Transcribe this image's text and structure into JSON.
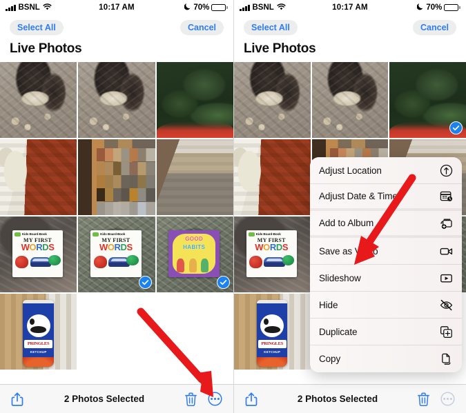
{
  "status_bar": {
    "carrier": "BSNL",
    "wifi_icon": "wifi-icon",
    "signal_icon": "signal-bars-icon",
    "time": "10:17 AM",
    "moon_icon": "moon-crescent-icon",
    "battery_percent": "70%",
    "battery_icon": "battery-icon"
  },
  "nav": {
    "select_all_label": "Select All",
    "cancel_label": "Cancel"
  },
  "page_title": "Live Photos",
  "toolbar": {
    "share_icon": "share-icon",
    "selection_label": "2 Photos Selected",
    "trash_icon": "trash-icon",
    "more_icon": "ellipsis-circle-icon"
  },
  "context_menu": {
    "items": [
      {
        "label": "Adjust Location",
        "icon": "location-arrow-icon",
        "group_end": false
      },
      {
        "label": "Adjust Date & Time",
        "icon": "calendar-clock-icon",
        "group_end": true
      },
      {
        "label": "Add to Album",
        "icon": "album-add-icon",
        "group_end": true
      },
      {
        "label": "Save as Video",
        "icon": "video-camera-icon",
        "group_end": false
      },
      {
        "label": "Slideshow",
        "icon": "play-rectangle-icon",
        "group_end": false
      },
      {
        "label": "Hide",
        "icon": "eye-slash-icon",
        "group_end": false
      },
      {
        "label": "Duplicate",
        "icon": "duplicate-plus-icon",
        "group_end": false
      },
      {
        "label": "Copy",
        "icon": "copy-pages-icon",
        "group_end": false
      }
    ]
  },
  "left_panel": {
    "photos": [
      {
        "art": "pic-feet",
        "selected": false
      },
      {
        "art": "pic-feet",
        "selected": false
      },
      {
        "art": "pic-trees",
        "selected": false
      },
      {
        "art": "pic-chair",
        "selected": false
      },
      {
        "art": "pic-blur",
        "selected": false
      },
      {
        "art": "pic-road",
        "selected": false
      },
      {
        "art": "pic-lap",
        "selected": false
      },
      {
        "art": "pic-carpet",
        "selected": true
      },
      {
        "art": "pic-carpet",
        "selected": true
      },
      {
        "art": "pic-wood",
        "selected": false
      }
    ]
  },
  "right_panel": {
    "photos": [
      {
        "art": "pic-feet",
        "selected": false
      },
      {
        "art": "pic-feet",
        "selected": false
      },
      {
        "art": "pic-trees",
        "selected": true
      },
      {
        "art": "pic-chair",
        "selected": false
      },
      {
        "art": "pic-blur",
        "selected": false
      },
      {
        "art": "pic-road",
        "selected": false
      },
      {
        "art": "pic-lap",
        "selected": false
      },
      {
        "art": "pic-carpet",
        "selected": false
      },
      {
        "art": "pic-carpet",
        "selected": false
      },
      {
        "art": "pic-wood",
        "selected": false
      }
    ]
  },
  "annotations": {
    "arrow_color": "#e8191b",
    "left_arrow_target": "ellipsis-circle-icon",
    "right_arrow_target": "Save as Video"
  },
  "colors": {
    "accent_blue": "#2f7cf6",
    "selection_blue": "#1b82f0",
    "toolbar_bg": "#f7f7f7",
    "menu_bg": "#f9f6f5",
    "arrow_red": "#e8191b"
  }
}
